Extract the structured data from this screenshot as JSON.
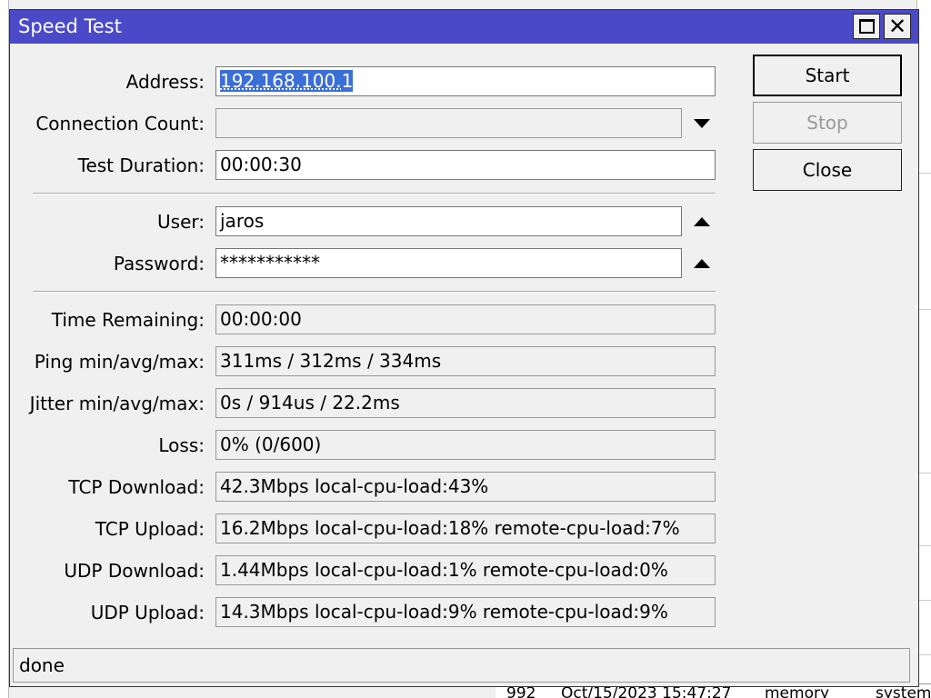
{
  "window": {
    "title": "Speed Test"
  },
  "fields": {
    "address": {
      "label": "Address:",
      "value_selected": "192.168.100.",
      "value_rest": "1"
    },
    "connection_count": {
      "label": "Connection Count:",
      "value": ""
    },
    "test_duration": {
      "label": "Test Duration:",
      "value": "00:00:30"
    },
    "user": {
      "label": "User:",
      "value": "jaros"
    },
    "password": {
      "label": "Password:",
      "value": "***********"
    }
  },
  "results": {
    "time_remaining": {
      "label": "Time Remaining:",
      "value": "00:00:00"
    },
    "ping": {
      "label": "Ping min/avg/max:",
      "value": "311ms / 312ms / 334ms"
    },
    "jitter": {
      "label": "Jitter min/avg/max:",
      "value": "0s / 914us / 22.2ms"
    },
    "loss": {
      "label": "Loss:",
      "value": "0% (0/600)"
    },
    "tcp_download": {
      "label": "TCP Download:",
      "value": "42.3Mbps local-cpu-load:43%"
    },
    "tcp_upload": {
      "label": "TCP Upload:",
      "value": "16.2Mbps local-cpu-load:18% remote-cpu-load:7%"
    },
    "udp_download": {
      "label": "UDP Download:",
      "value": "1.44Mbps local-cpu-load:1% remote-cpu-load:0%"
    },
    "udp_upload": {
      "label": "UDP Upload:",
      "value": "14.3Mbps local-cpu-load:9% remote-cpu-load:9%"
    }
  },
  "buttons": {
    "start": "Start",
    "stop": "Stop",
    "close": "Close"
  },
  "status": "done",
  "background": {
    "row_id": "992",
    "row_time": "Oct/15/2023 15:47:27",
    "row_topic": "memory",
    "row_extra": "system"
  },
  "colors": {
    "titlebar": "#4a4ac8",
    "selection": "#3b6fd8",
    "window_bg": "#f0f0f0"
  }
}
